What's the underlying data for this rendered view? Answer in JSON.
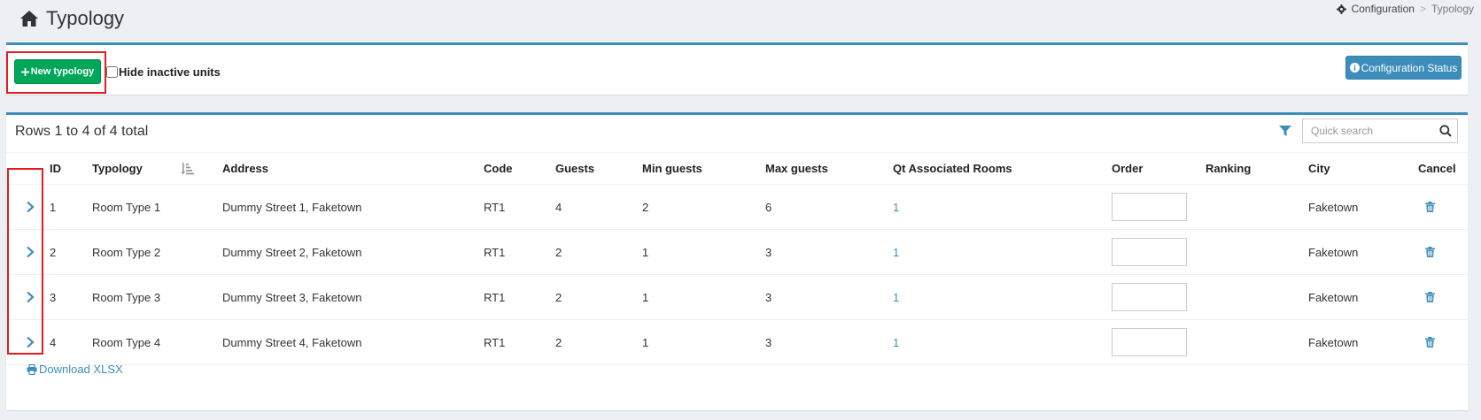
{
  "header": {
    "title": "Typology",
    "breadcrumb": {
      "parent": "Configuration",
      "separator": ">",
      "current": "Typology"
    }
  },
  "toolbar": {
    "new_label": "New typology",
    "hide_inactive_label": "Hide inactive units",
    "status_label": "Configuration Status"
  },
  "table": {
    "rows_info": "Rows 1 to 4 of 4 total",
    "search_placeholder": "Quick search",
    "columns": {
      "id": "ID",
      "typology": "Typology",
      "address": "Address",
      "code": "Code",
      "guests": "Guests",
      "min_guests": "Min guests",
      "max_guests": "Max guests",
      "qt_rooms": "Qt Associated Rooms",
      "order": "Order",
      "ranking": "Ranking",
      "city": "City",
      "cancel": "Cancel"
    },
    "rows": [
      {
        "id": "1",
        "typology": "Room Type 1",
        "address": "Dummy Street 1, Faketown",
        "code": "RT1",
        "guests": "4",
        "min_guests": "2",
        "max_guests": "6",
        "qt_rooms": "1",
        "order": "",
        "ranking": "",
        "city": "Faketown"
      },
      {
        "id": "2",
        "typology": "Room Type 2",
        "address": "Dummy Street 2, Faketown",
        "code": "RT1",
        "guests": "2",
        "min_guests": "1",
        "max_guests": "3",
        "qt_rooms": "1",
        "order": "",
        "ranking": "",
        "city": "Faketown"
      },
      {
        "id": "3",
        "typology": "Room Type 3",
        "address": "Dummy Street 3, Faketown",
        "code": "RT1",
        "guests": "2",
        "min_guests": "1",
        "max_guests": "3",
        "qt_rooms": "1",
        "order": "",
        "ranking": "",
        "city": "Faketown"
      },
      {
        "id": "4",
        "typology": "Room Type 4",
        "address": "Dummy Street 4, Faketown",
        "code": "RT1",
        "guests": "2",
        "min_guests": "1",
        "max_guests": "3",
        "qt_rooms": "1",
        "order": "",
        "ranking": "",
        "city": "Faketown"
      }
    ],
    "download_label": "Download XLSX"
  },
  "icons": {
    "home": "home-icon",
    "breadcrumb": "gear-icon",
    "new": "plus-icon",
    "status": "info-circle-icon",
    "filter": "filter-icon",
    "search": "search-icon",
    "sort": "sort-amount-icon",
    "expand": "chevron-right-icon",
    "cancel": "trash-icon",
    "download": "print-icon"
  },
  "colors": {
    "accent": "#3c8dbc",
    "success": "#00a65a",
    "highlight_frame": "#e21d1d",
    "background": "#ecf0f5"
  }
}
